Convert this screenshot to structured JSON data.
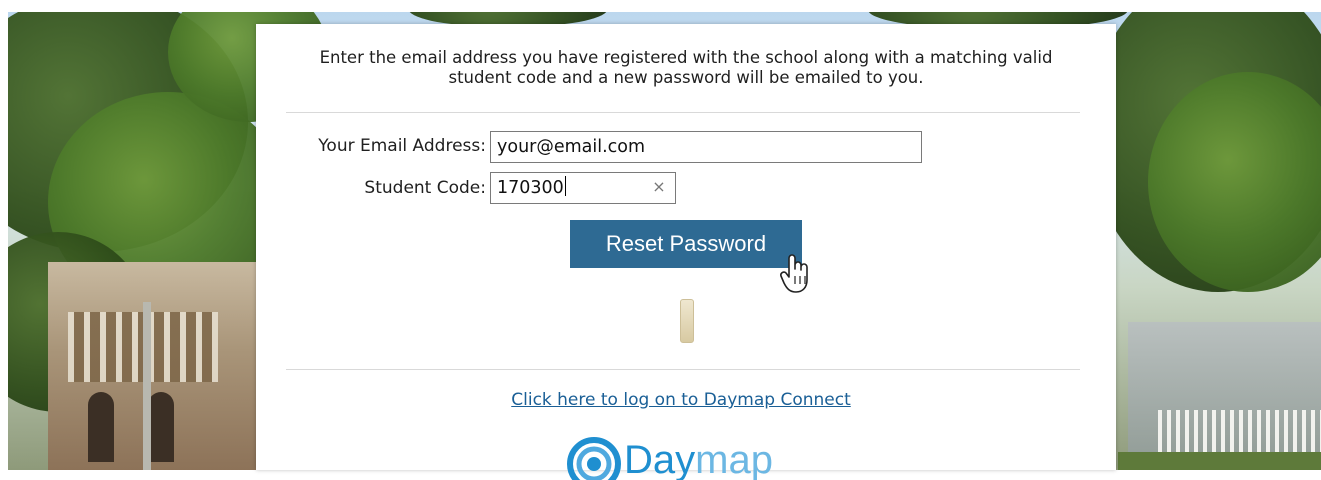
{
  "instructions": "Enter the email address you have registered with the school along with a matching valid student code and a new password will be emailed to you.",
  "form": {
    "email_label": "Your Email Address:",
    "email_value": "your@email.com",
    "code_label": "Student Code:",
    "code_value": "170300",
    "clear_glyph": "×",
    "submit_label": "Reset Password"
  },
  "link_text": "Click here to log on to Daymap Connect",
  "logo": {
    "part1": "Day",
    "part2": "map"
  },
  "colors": {
    "button": "#2e6a93",
    "link": "#1a5f96",
    "logo": "#1f8fd0"
  },
  "icons": [
    "hand-cursor-icon",
    "daymap-logo-icon"
  ]
}
